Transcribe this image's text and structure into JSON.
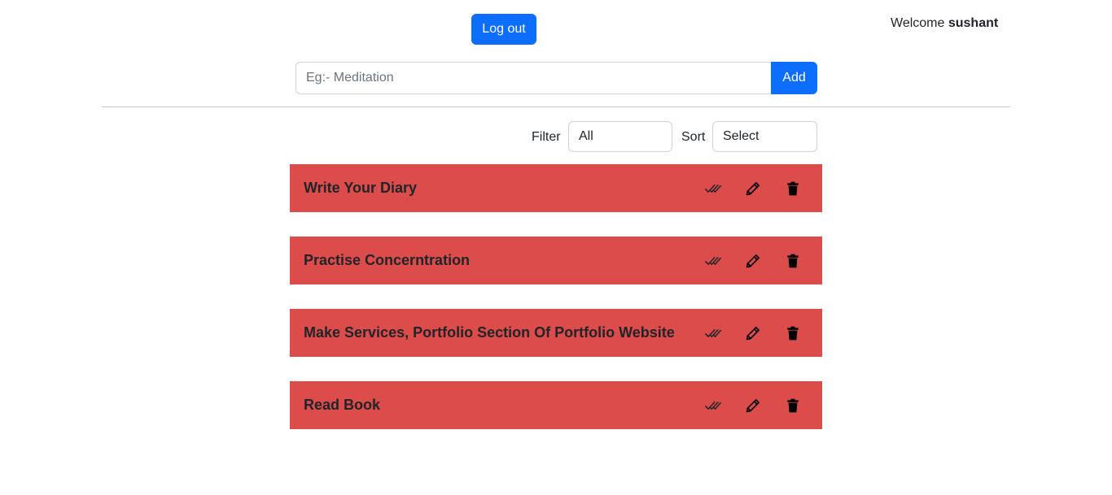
{
  "header": {
    "logout_label": "Log out",
    "welcome_prefix": "Welcome",
    "username": "sushant"
  },
  "add_form": {
    "placeholder": "Eg:- Meditation",
    "value": "",
    "add_label": "Add"
  },
  "controls": {
    "filter_label": "Filter",
    "filter_value": "All",
    "sort_label": "Sort",
    "sort_value": "Select"
  },
  "todos": [
    {
      "title": "Write Your Diary"
    },
    {
      "title": "Practise Concerntration"
    },
    {
      "title": "Make Services, Portfolio Section Of Portfolio Website"
    },
    {
      "title": "Read Book"
    }
  ],
  "icons": {
    "complete": "double-check-icon",
    "edit": "pencil-icon",
    "delete": "trash-icon"
  },
  "colors": {
    "primary": "#0d6efd",
    "todo_background": "#db4c4b",
    "divider": "#c8c8c8"
  }
}
